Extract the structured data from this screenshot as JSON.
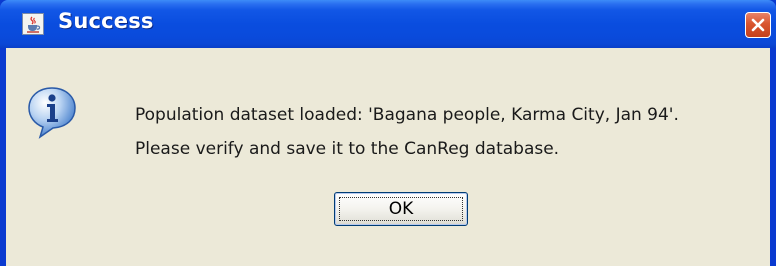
{
  "window": {
    "title": "Success",
    "app_icon": "java-cup-icon",
    "close_icon": "close-icon"
  },
  "dialog": {
    "icon": "information-icon",
    "message_lines": [
      "Population dataset loaded: 'Bagana people, Karma City, Jan 94'.",
      "Please verify and save it to the CanReg database."
    ],
    "ok_label": "OK"
  },
  "colors": {
    "titlebar": "#0a4ddf",
    "frame": "#0a3ad0",
    "body_background": "#ece9d8",
    "close_button": "#d9552f",
    "info_bubble": "#3a76c8"
  }
}
